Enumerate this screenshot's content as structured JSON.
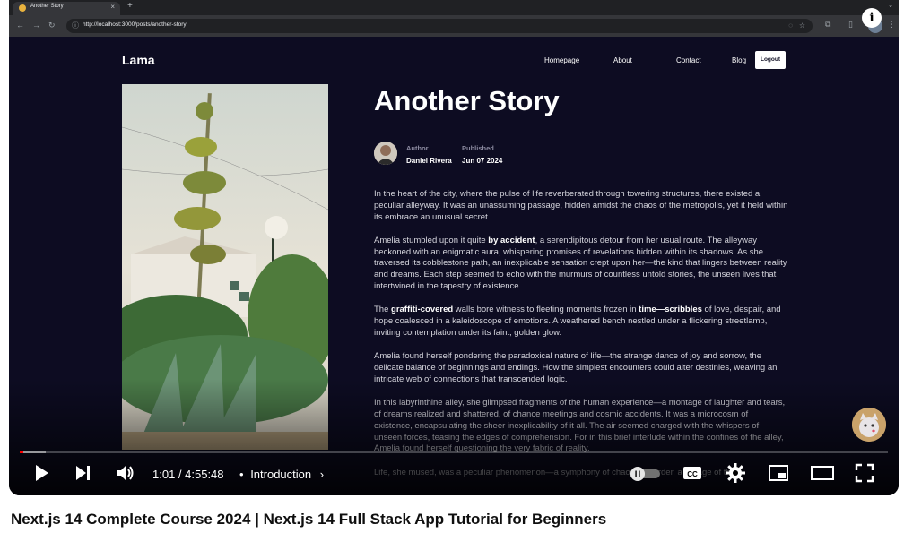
{
  "browser": {
    "tab_title": "Another Story",
    "url": "http://localhost:3000/posts/another-story"
  },
  "site": {
    "logo": "Lama",
    "nav": [
      "Homepage",
      "About",
      "Contact",
      "Blog"
    ],
    "logout": "Logout"
  },
  "post": {
    "title": "Another Story",
    "author_label": "Author",
    "author": "Daniel Rivera",
    "published_label": "Published",
    "published": "Jun 07 2024",
    "paragraphs": [
      {
        "parts": [
          {
            "t": "In the heart of the city, where the pulse of life reverberated through towering structures, there existed a peculiar alleyway. It was an unassuming passage, hidden amidst the chaos of the metropolis, yet it held within its embrace an unusual secret."
          }
        ]
      },
      {
        "parts": [
          {
            "t": "Amelia stumbled upon it quite "
          },
          {
            "t": "by accident",
            "b": true
          },
          {
            "t": ", a serendipitous detour from her usual route. The alleyway beckoned with an enigmatic aura, whispering promises of revelations hidden within its shadows. As she traversed its cobblestone path, an inexplicable sensation crept upon her—the kind that lingers between reality and dreams. Each step seemed to echo with the murmurs of countless untold stories, the unseen lives that intertwined in the tapestry of existence."
          }
        ]
      },
      {
        "parts": [
          {
            "t": "The "
          },
          {
            "t": "graffiti-covered",
            "b": true
          },
          {
            "t": " walls bore witness to fleeting moments frozen in "
          },
          {
            "t": "time—scribbles",
            "b": true
          },
          {
            "t": " of love, despair, and hope coalesced in a kaleidoscope of emotions. A weathered bench nestled under a flickering streetlamp, inviting contemplation under its faint, golden glow."
          }
        ]
      },
      {
        "parts": [
          {
            "t": "Amelia found herself pondering the paradoxical nature of life—the strange dance of joy and sorrow, the delicate balance of beginnings and endings. How the simplest encounters could alter destinies, weaving an intricate web of connections that transcended logic."
          }
        ]
      },
      {
        "parts": [
          {
            "t": "In this labyrinthine alley, she glimpsed fragments of the human experience—a montage of laughter and tears, of dreams realized and shattered, of chance meetings and cosmic accidents. It was a microcosm of existence, encapsulating the sheer inexplicability of it all. The air seemed charged with the whispers of unseen forces, teasing the edges of comprehension. For in this brief interlude within the confines of the alley, Amelia found herself questioning the very fabric of reality."
          }
        ]
      },
      {
        "parts": [
          {
            "t": "Life, she mused, was a peculiar phenomenon—a symphony of chaos and order, a collage of the"
          }
        ]
      }
    ]
  },
  "player": {
    "time": "1:01 / 4:55:48",
    "chapter": "Introduction",
    "separator": "•",
    "progress_played": 0.004,
    "progress_loaded": 0.03,
    "icons": [
      "play-icon",
      "next-icon",
      "volume-icon",
      "autoplay-toggle",
      "captions-icon",
      "settings-icon",
      "miniplayer-icon",
      "theater-icon",
      "fullscreen-icon"
    ],
    "autoplay_on": false
  },
  "video": {
    "title": "Next.js 14 Complete Course 2024 | Next.js 14 Full Stack App Tutorial for Beginners"
  },
  "colors": {
    "site_bg": "#0d0c22",
    "progress_red": "#ff0000"
  }
}
